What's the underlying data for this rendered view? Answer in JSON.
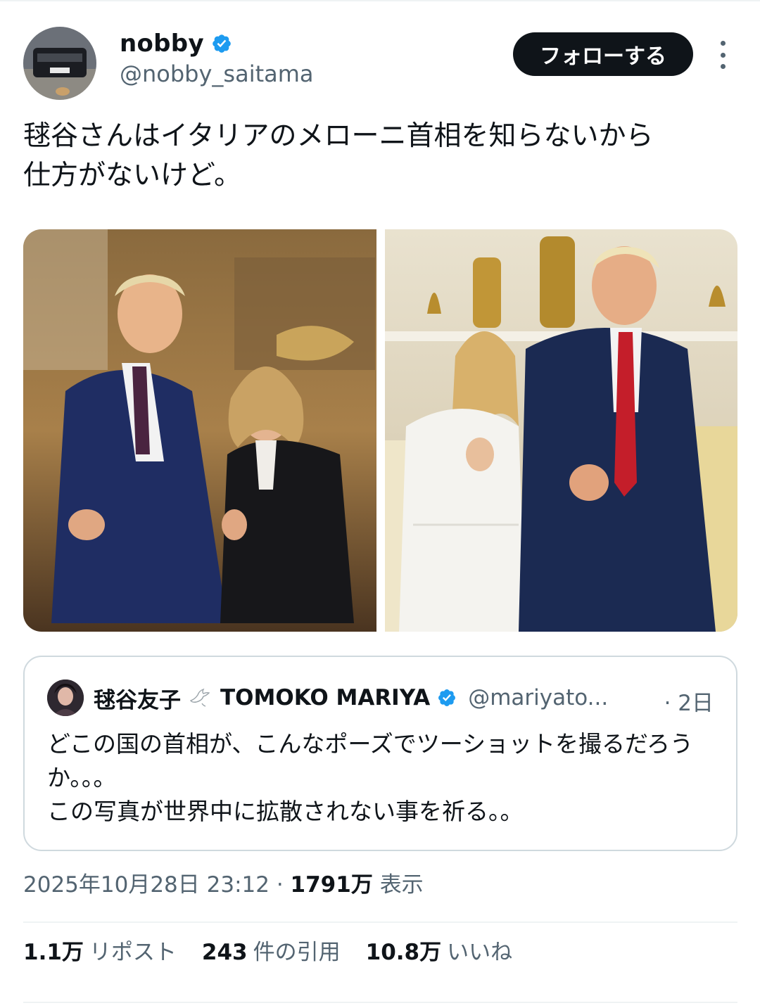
{
  "author": {
    "display_name": "nobby",
    "handle": "@nobby_saitama",
    "verified": true,
    "verified_color": "#1d9bf0"
  },
  "actions": {
    "follow_label": "フォローする",
    "more_icon": "more-horizontal-icon"
  },
  "tweet": {
    "text": "毬谷さんはイタリアのメローニ首相を知らないから\n仕方がないけど。"
  },
  "media": {
    "photo_count": 2
  },
  "quote": {
    "display_name": "毬谷友子",
    "emoji_icon": "dove-icon",
    "display_name_latin": "TOMOKO MARIYA",
    "verified": true,
    "handle": "@mariyato...",
    "time": "· 2日",
    "text": "どこの国の首相が、こんなポーズでツーショットを撮るだろうか。。。\nこの写真が世界中に拡散されない事を祈る。。"
  },
  "meta": {
    "datetime": "2025年10月28日 23:12",
    "separator": " · ",
    "views_count": "1791万",
    "views_label": "表示"
  },
  "stats": {
    "reposts_count": "1.1万",
    "reposts_label": "リポスト",
    "quotes_count": "243",
    "quotes_label": "件の引用",
    "likes_count": "10.8万",
    "likes_label": "いいね"
  }
}
